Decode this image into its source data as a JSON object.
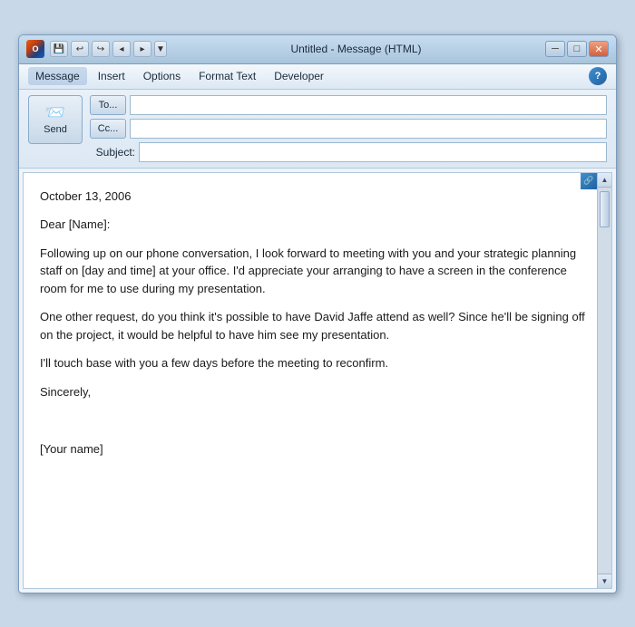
{
  "window": {
    "title": "Untitled - Message (HTML)",
    "icon_label": "O",
    "min_btn": "─",
    "max_btn": "□",
    "close_btn": "✕"
  },
  "toolbar_buttons": [
    {
      "label": "↩",
      "name": "undo"
    },
    {
      "label": "↪",
      "name": "redo"
    },
    {
      "label": "◂",
      "name": "back"
    },
    {
      "label": "▸",
      "name": "forward"
    },
    {
      "label": "▼",
      "name": "dropdown"
    }
  ],
  "menu": {
    "items": [
      {
        "label": "Message",
        "name": "message",
        "active": true
      },
      {
        "label": "Insert",
        "name": "insert"
      },
      {
        "label": "Options",
        "name": "options"
      },
      {
        "label": "Format Text",
        "name": "format-text"
      },
      {
        "label": "Developer",
        "name": "developer"
      }
    ],
    "help_label": "?"
  },
  "compose": {
    "send_label": "Send",
    "send_icon": "✉",
    "to_label": "To...",
    "cc_label": "Cc...",
    "subject_label": "Subject:",
    "to_value": "",
    "cc_value": "",
    "subject_value": ""
  },
  "body": {
    "date": "October 13, 2006",
    "greeting": "Dear [Name]:",
    "paragraph1": "Following up on our phone conversation, I look forward to meeting with you and your strategic planning staff on [day and time] at your office. I'd appreciate your arranging to have a screen in the conference room for me to use during my presentation.",
    "paragraph2": "One other request, do you think it's possible to have David Jaffe attend as well? Since he'll be signing off on the project, it would be helpful to have him see my presentation.",
    "paragraph3": "I'll touch base with you a few days before the meeting to reconfirm.",
    "closing": "Sincerely,",
    "signature": "[Your name]"
  }
}
